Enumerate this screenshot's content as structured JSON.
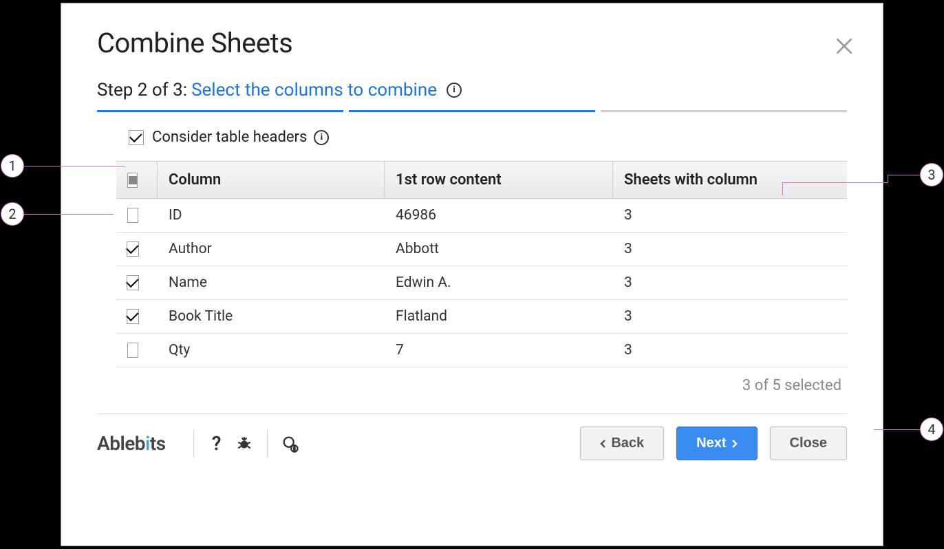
{
  "title": "Combine Sheets",
  "step": {
    "prefix": "Step 2 of 3: ",
    "label": "Select the columns to combine"
  },
  "option": {
    "consider_headers": "Consider table headers"
  },
  "table": {
    "headers": {
      "column": "Column",
      "first_row": "1st row content",
      "sheets": "Sheets with column"
    },
    "rows": [
      {
        "checked": false,
        "column": "ID",
        "first_row": "46986",
        "sheets": "3"
      },
      {
        "checked": true,
        "column": "Author",
        "first_row": "Abbott",
        "sheets": "3"
      },
      {
        "checked": true,
        "column": "Name",
        "first_row": "Edwin A.",
        "sheets": "3"
      },
      {
        "checked": true,
        "column": "Book Title",
        "first_row": "Flatland",
        "sheets": "3"
      },
      {
        "checked": false,
        "column": "Qty",
        "first_row": "7",
        "sheets": "3"
      }
    ]
  },
  "selection_count": "3 of 5 selected",
  "footer": {
    "brand": "Ablebits",
    "back": "Back",
    "next": "Next",
    "close": "Close"
  },
  "callouts": {
    "1": "1",
    "2": "2",
    "3": "3",
    "4": "4"
  }
}
